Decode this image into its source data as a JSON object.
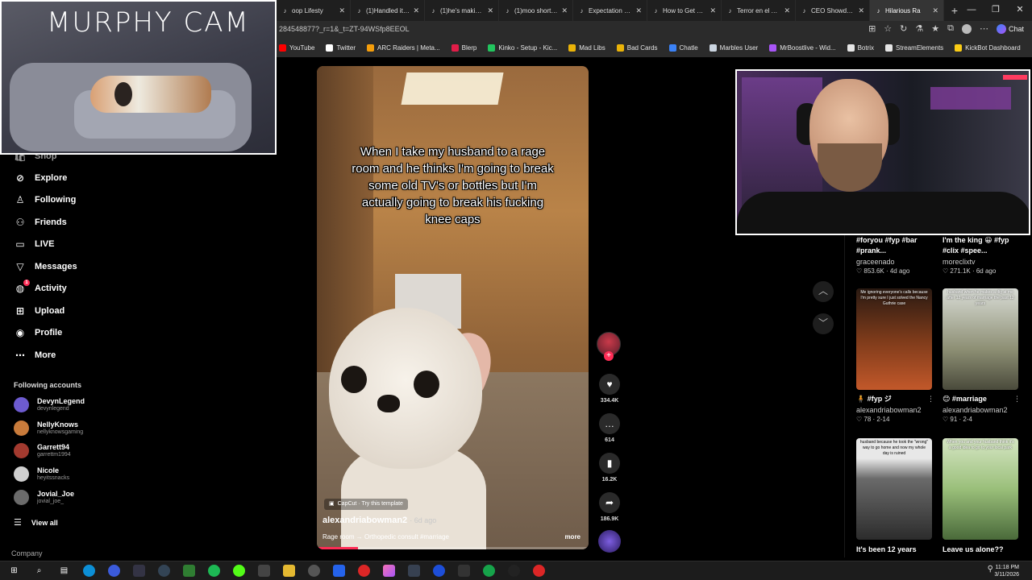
{
  "browser": {
    "tabs": [
      {
        "label": "oop Lifesty",
        "active": false
      },
      {
        "label": "(1)Handled it pr",
        "active": false
      },
      {
        "label": "(1)he's making a",
        "active": false
      },
      {
        "label": "(1)moo short #n",
        "active": false
      },
      {
        "label": "Expectation vs. R",
        "active": false
      },
      {
        "label": "How to Get Your",
        "active": false
      },
      {
        "label": "Terror en el Asce",
        "active": false
      },
      {
        "label": "CEO Showdown:",
        "active": false
      },
      {
        "label": "Hilarious Ra",
        "active": true
      }
    ],
    "url": "284548877?_r=1&_t=ZT-94WSfp8EEOL",
    "chat_label": "Chat",
    "bookmarks": [
      {
        "label": "YouTube",
        "icon": "youtube-icon",
        "color": "#ff0000"
      },
      {
        "label": "Twitter",
        "icon": "x-icon",
        "color": "#ffffff"
      },
      {
        "label": "ARC Raiders | Meta...",
        "icon": "flame-icon",
        "color": "#f59e0b"
      },
      {
        "label": "Blerp",
        "icon": "blerp-icon",
        "color": "#e11d48"
      },
      {
        "label": "Kinko - Setup - Kic...",
        "icon": "kinko-icon",
        "color": "#22c55e"
      },
      {
        "label": "Mad Libs",
        "icon": "folder-icon",
        "color": "#eab308"
      },
      {
        "label": "Bad Cards",
        "icon": "folder-icon",
        "color": "#eab308"
      },
      {
        "label": "Chatle",
        "icon": "chatle-icon",
        "color": "#3b82f6"
      },
      {
        "label": "Marbles User",
        "icon": "globe-icon",
        "color": "#cbd5e1"
      },
      {
        "label": "MrBoostlive - Wid...",
        "icon": "boost-icon",
        "color": "#a855f7"
      },
      {
        "label": "Botrix",
        "icon": "diamond-icon",
        "color": "#e5e5e5"
      },
      {
        "label": "StreamElements",
        "icon": "streamelements-icon",
        "color": "#e5e5e5"
      },
      {
        "label": "KickBot Dashboard",
        "icon": "kickbot-icon",
        "color": "#facc15"
      }
    ]
  },
  "overlays": {
    "murphy_cam_title": "MURPHY CAM"
  },
  "sidebar": {
    "partial_item": "Shop",
    "items": [
      {
        "label": "Explore",
        "icon": "compass-icon"
      },
      {
        "label": "Following",
        "icon": "following-icon"
      },
      {
        "label": "Friends",
        "icon": "friends-icon"
      },
      {
        "label": "LIVE",
        "icon": "live-icon"
      },
      {
        "label": "Messages",
        "icon": "messages-icon"
      },
      {
        "label": "Activity",
        "icon": "activity-icon",
        "badge": "1"
      },
      {
        "label": "Upload",
        "icon": "upload-icon"
      },
      {
        "label": "Profile",
        "icon": "profile-icon"
      },
      {
        "label": "More",
        "icon": "more-icon"
      }
    ],
    "following_header": "Following accounts",
    "accounts": [
      {
        "name": "DevynLegend",
        "handle": "devynlegend",
        "color": "#6d5bd0"
      },
      {
        "name": "NellyKnows",
        "handle": "nellyknowsgaming",
        "color": "#c97b3b"
      },
      {
        "name": "Garrett94",
        "handle": "garrettm1994",
        "color": "#a33a2f"
      },
      {
        "name": "Nicole",
        "handle": "heyitssnacks",
        "color": "#cfcfcf"
      },
      {
        "name": "Jovial_Joe",
        "handle": "jovial_joe_",
        "color": "#6b6b6b"
      }
    ],
    "view_all": "View all",
    "company": "Company"
  },
  "video": {
    "caption": "When I take my husband to a rage room and he thinks I'm going to break some old TV's or bottles but I'm actually going to break his fucking knee caps",
    "capcut": "CapCut · Try this template",
    "author": "alexandriabowman2",
    "time": "· 6d ago",
    "description": "Rage room → Orthopedic consult #marriage",
    "more": "more",
    "progress_fraction": 0.15
  },
  "actions": {
    "likes": "334.4K",
    "comments": "614",
    "saves": "16.2K",
    "shares": "186.9K"
  },
  "recommended": {
    "top": [
      {
        "title": "#foryou #fyp #bar #prank...",
        "author": "graceenado",
        "meta": "♡ 853.6K · 4d ago"
      },
      {
        "title": "I'm the king 😀 #fyp #clix #spee...",
        "author": "moreclixtv",
        "meta": "♡ 271.1K · 6d ago"
      }
    ],
    "mid": [
      {
        "thumb_caption": "Me ignoring everyone's calls because I'm pretty sure I just solved the Nancy Guthrie case",
        "title": "🧍 #fyp ジ",
        "author": "alexandriabowman2",
        "meta": "♡ 78 · 2-14"
      },
      {
        "thumb_caption": "husband when he makes a dig at me after 12 years of marriage the past 12 years",
        "title": "😊 #marriage",
        "author": "alexandriabowman2",
        "meta": "♡ 91 · 2-4"
      }
    ],
    "bottom": [
      {
        "thumb_caption": "husband because he took the \"wrong\" way to go home and now my whole day is ruined",
        "title": "It's been 12 years"
      },
      {
        "thumb_caption": "When you and your husband think it's a good idea to go to your local park",
        "title": "Leave us alone??"
      }
    ]
  },
  "taskbar": {
    "time": "11:18 PM",
    "date": "3/11/2026"
  },
  "colors": {
    "accent": "#fe2c55"
  }
}
